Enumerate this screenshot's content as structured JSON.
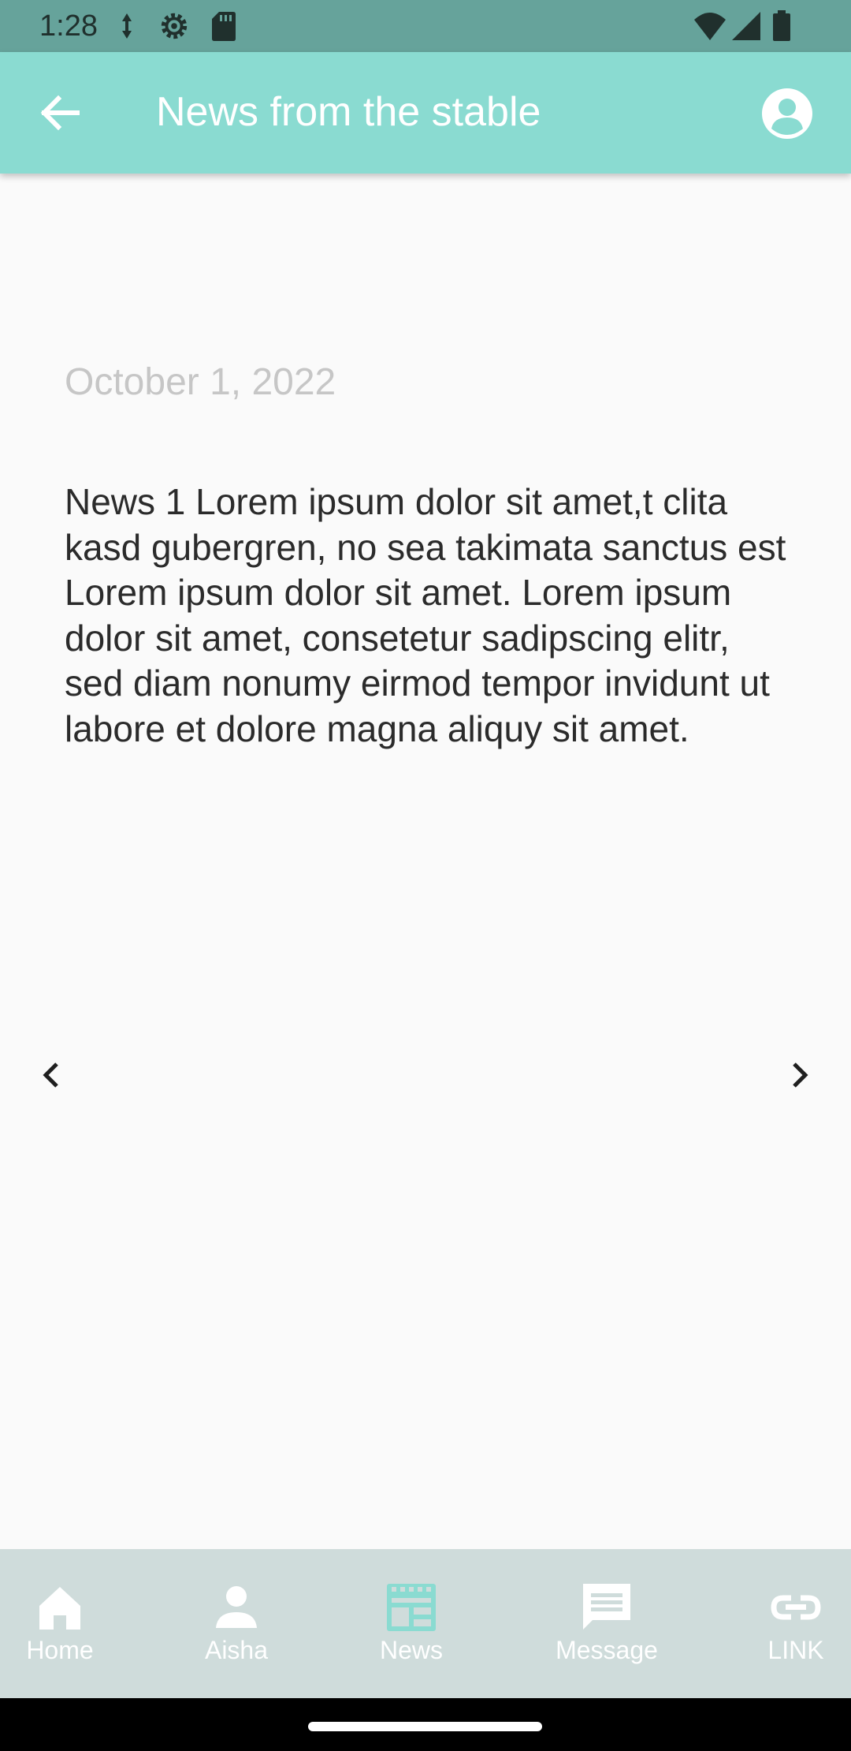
{
  "status_bar": {
    "time": "1:28"
  },
  "app_bar": {
    "title": "News from the stable"
  },
  "news": {
    "date": "October 1, 2022",
    "body": "News 1 Lorem ipsum dolor sit amet,t clita kasd gubergren, no sea takimata sanctus est Lorem ipsum dolor sit amet. Lorem ipsum dolor sit amet, consetetur sadipscing elitr, sed diam nonumy eirmod tempor invidunt ut labore et dolore magna aliquy sit amet."
  },
  "bottom_nav": {
    "items": [
      {
        "label": "Home",
        "icon": "home-icon"
      },
      {
        "label": "Aisha",
        "icon": "person-icon"
      },
      {
        "label": "News",
        "icon": "news-icon",
        "active": true
      },
      {
        "label": "Message",
        "icon": "message-icon"
      },
      {
        "label": "LINK",
        "icon": "link-icon"
      }
    ]
  },
  "colors": {
    "status_bar": "#66a39b",
    "app_bar": "#8adbd1",
    "accent": "#8adbd1",
    "nav_background": "#cfdcdb",
    "date_text": "#c6c6c6",
    "body_text": "#2b2b2b"
  }
}
